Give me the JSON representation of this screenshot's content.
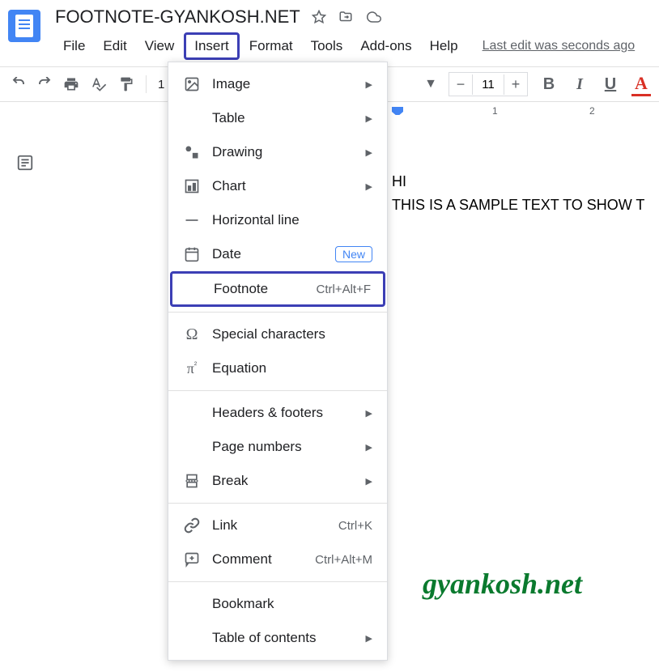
{
  "header": {
    "title": "FOOTNOTE-GYANKOSH.NET"
  },
  "menu": {
    "items": [
      "File",
      "Edit",
      "View",
      "Insert",
      "Format",
      "Tools",
      "Add-ons",
      "Help"
    ],
    "last_edit": "Last edit was seconds ago"
  },
  "toolbar": {
    "zoom": "1",
    "font_size": "11"
  },
  "ruler": {
    "marks": [
      "1",
      "2"
    ]
  },
  "document": {
    "line1": "HI",
    "line2": "THIS IS A SAMPLE TEXT TO SHOW T"
  },
  "dropdown": {
    "items": [
      {
        "label": "Image",
        "icon": "image",
        "arrow": true
      },
      {
        "label": "Table",
        "icon": "table",
        "arrow": true
      },
      {
        "label": "Drawing",
        "icon": "drawing",
        "arrow": true
      },
      {
        "label": "Chart",
        "icon": "chart",
        "arrow": true
      },
      {
        "label": "Horizontal line",
        "icon": "hline"
      },
      {
        "label": "Date",
        "icon": "date",
        "badge": "New"
      },
      {
        "label": "Footnote",
        "icon": "none",
        "shortcut": "Ctrl+Alt+F",
        "highlighted": true
      },
      {
        "divider": true
      },
      {
        "label": "Special characters",
        "icon": "omega"
      },
      {
        "label": "Equation",
        "icon": "pi"
      },
      {
        "divider": true
      },
      {
        "label": "Headers & footers",
        "icon": "none",
        "arrow": true
      },
      {
        "label": "Page numbers",
        "icon": "none",
        "arrow": true
      },
      {
        "label": "Break",
        "icon": "break",
        "arrow": true
      },
      {
        "divider": true
      },
      {
        "label": "Link",
        "icon": "link",
        "shortcut": "Ctrl+K"
      },
      {
        "label": "Comment",
        "icon": "comment",
        "shortcut": "Ctrl+Alt+M"
      },
      {
        "divider": true
      },
      {
        "label": "Bookmark",
        "icon": "none"
      },
      {
        "label": "Table of contents",
        "icon": "none",
        "arrow": true
      }
    ]
  },
  "watermark": "gyankosh.net"
}
